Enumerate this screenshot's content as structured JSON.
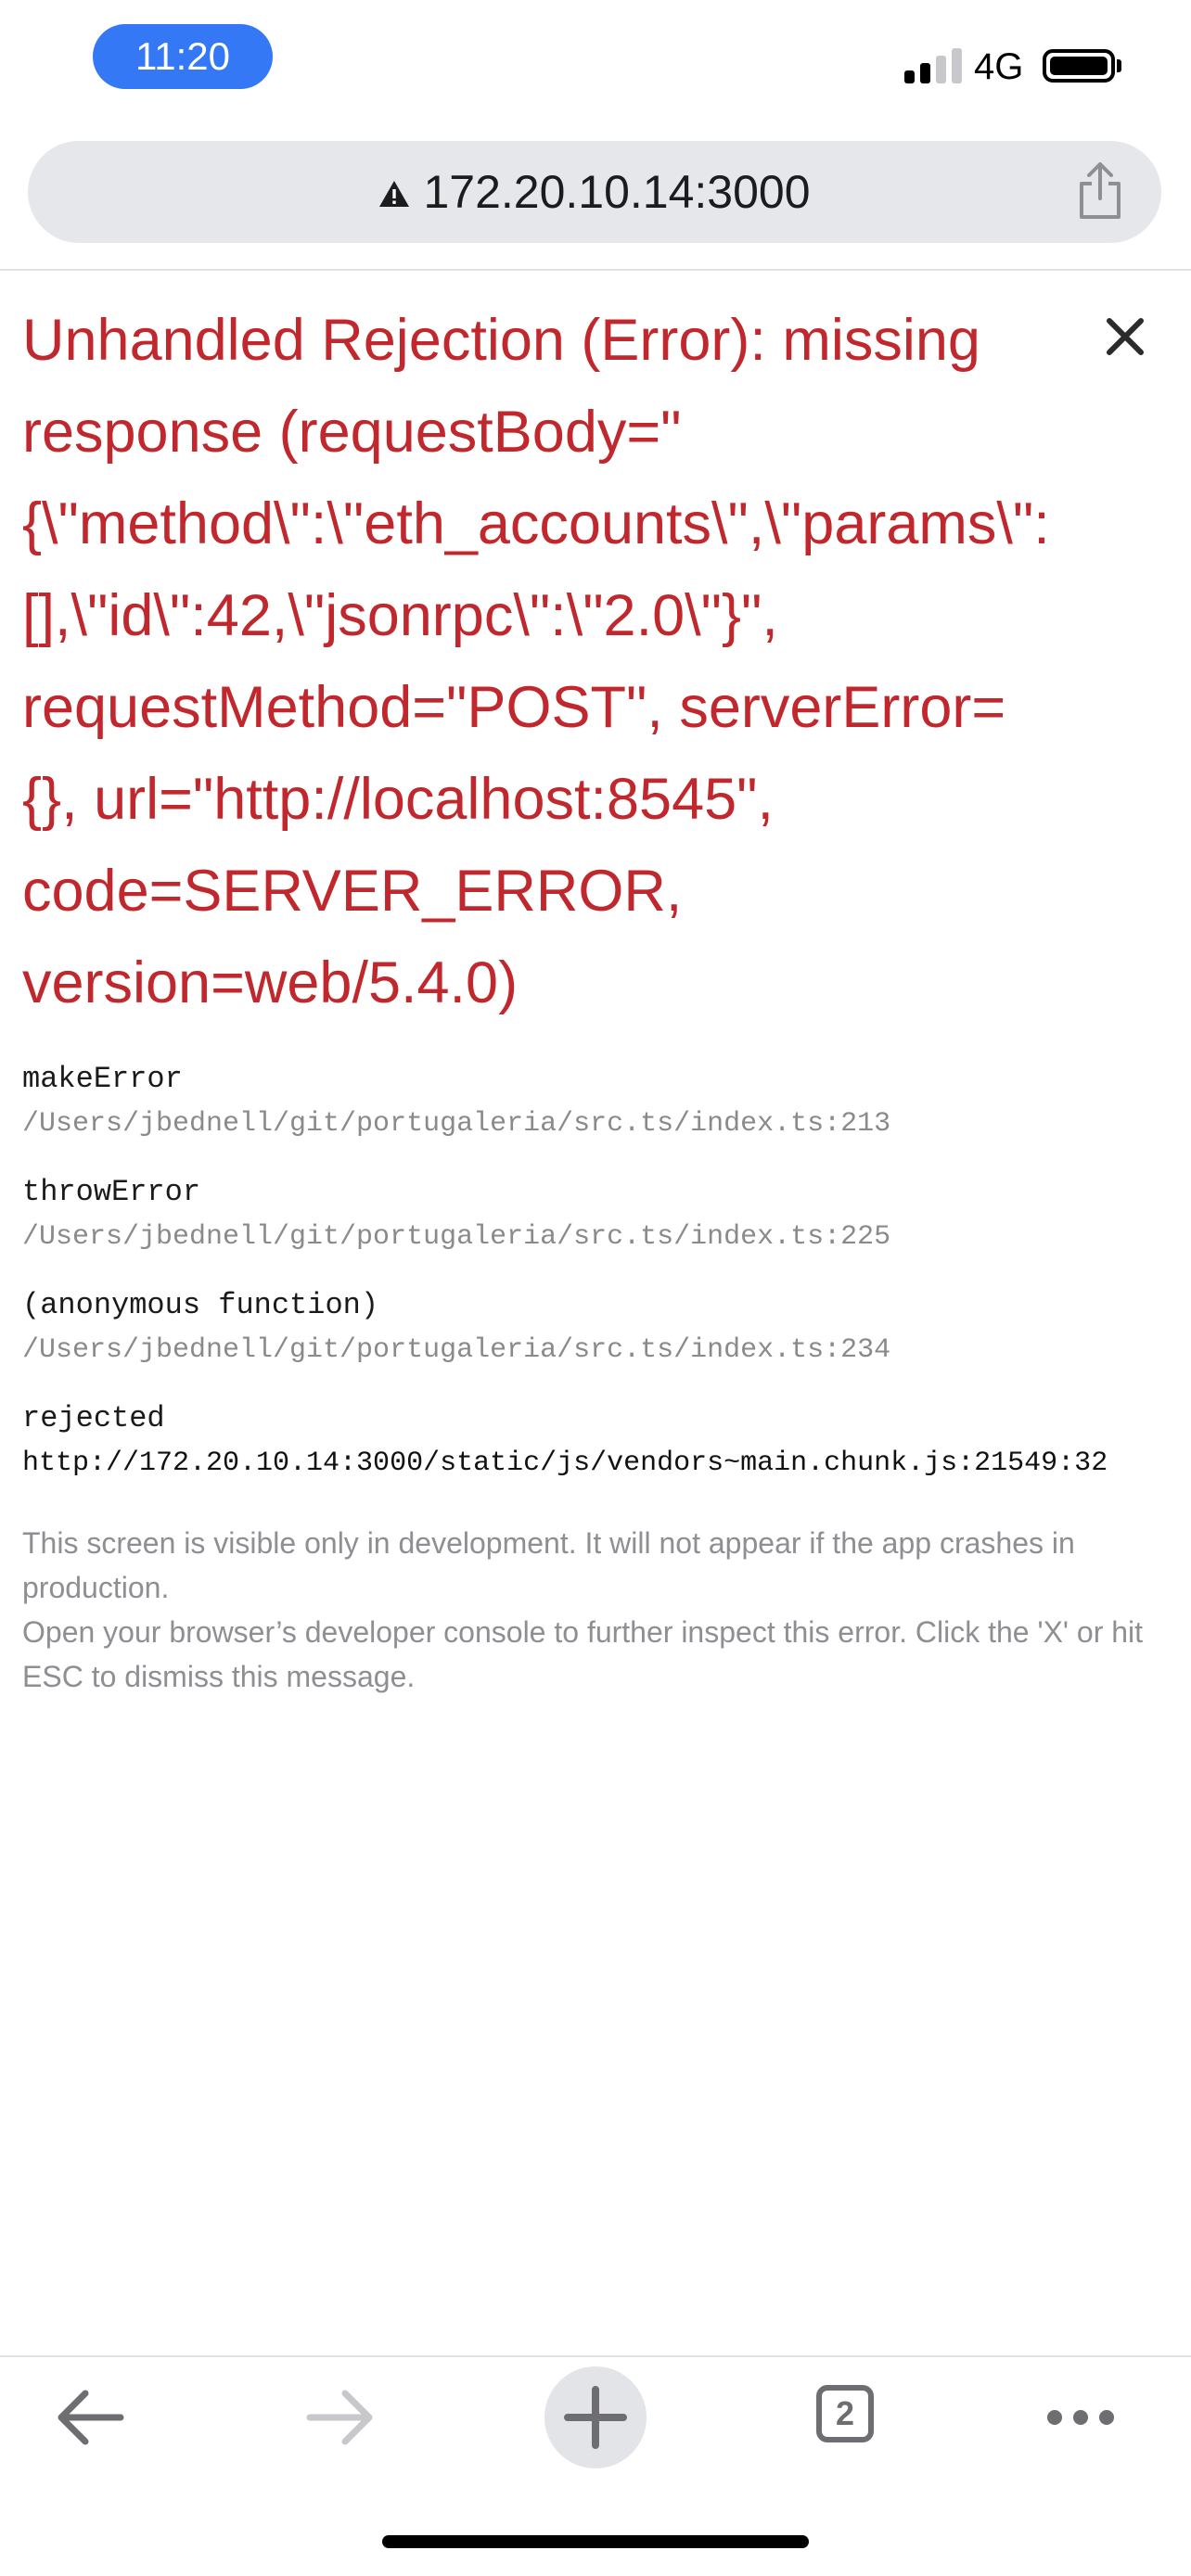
{
  "status_bar": {
    "time": "11:20",
    "network": "4G"
  },
  "browser": {
    "url": "172.20.10.14:3000",
    "tab_count": "2",
    "icons": [
      "warning-icon",
      "share-icon",
      "back-arrow-icon",
      "forward-arrow-icon",
      "plus-icon",
      "tabs-icon",
      "more-icon"
    ]
  },
  "error": {
    "title": "Unhandled Rejection (Error): missing response (requestBody=\"{\\\"method\\\":\\\"eth_accounts\\\",\\\"params\\\":[],\\\"id\\\":42,\\\"jsonrpc\\\":\\\"2.0\\\"}\", requestMethod=\"POST\", serverError={}, url=\"http://localhost:8545\", code=SERVER_ERROR, version=web/5.4.0)",
    "color": "#c0282d"
  },
  "stack": [
    {
      "fn": "makeError",
      "file": "/Users/jbednell/git/portugaleria/src.ts/index.ts:213"
    },
    {
      "fn": "throwError",
      "file": "/Users/jbednell/git/portugaleria/src.ts/index.ts:225"
    },
    {
      "fn": "(anonymous function)",
      "file": "/Users/jbednell/git/portugaleria/src.ts/index.ts:234"
    },
    {
      "fn": "rejected",
      "file": "http://172.20.10.14:3000/static/js/vendors~main.chunk.js:21549:32"
    }
  ],
  "footer": {
    "line1": "This screen is visible only in development. It will not appear if the app crashes in production.",
    "line2": "Open your browser’s developer console to further inspect this error.  Click the 'X' or hit ESC to dismiss this message."
  }
}
